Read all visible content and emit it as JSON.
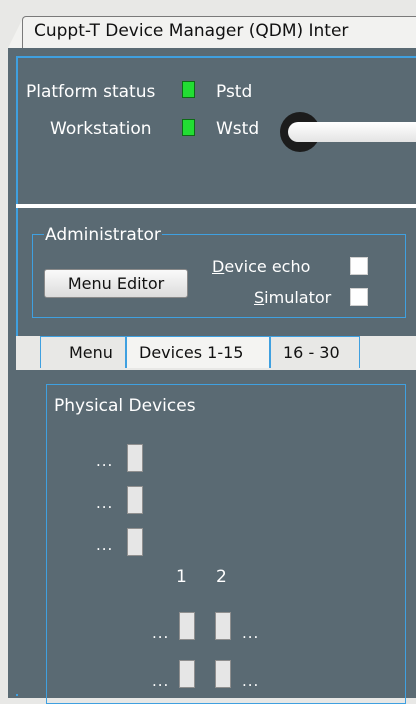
{
  "window": {
    "title": "Cuppt-T Device Manager (QDM)  Inter"
  },
  "status": {
    "platform_label": "Platform status",
    "platform_value": "Pstd",
    "workstation_label": "Workstation",
    "workstation_value": "Wstd",
    "led_color": "#22dd33"
  },
  "admin": {
    "legend": "Administrator",
    "menu_editor_label": "Menu Editor",
    "device_echo_underline": "D",
    "device_echo_rest": "evice echo",
    "simulator_underline": "S",
    "simulator_rest": "imulator"
  },
  "tabs": [
    {
      "label": "Menu"
    },
    {
      "label": "Devices 1-15"
    },
    {
      "label": "16 - 30"
    }
  ],
  "physical": {
    "title": "Physical Devices",
    "dots": "...",
    "columns": [
      "1",
      "2"
    ]
  },
  "colors": {
    "panel": "#5a6a73",
    "accent": "#3fa0e0"
  }
}
